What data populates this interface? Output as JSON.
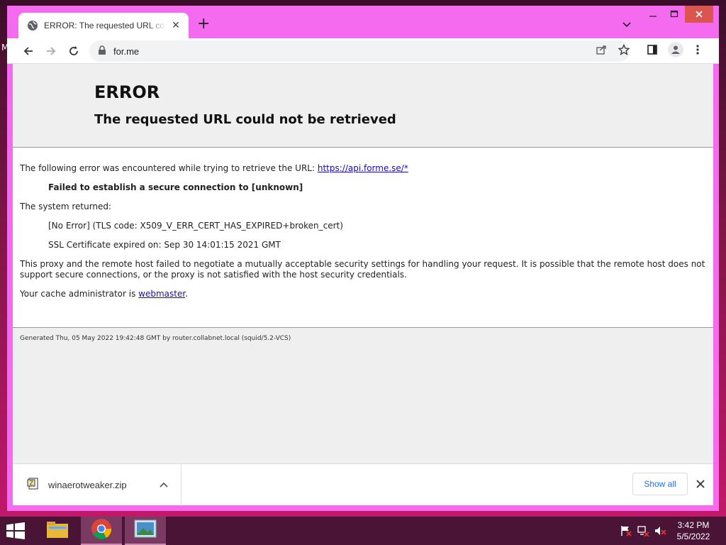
{
  "desktop": {
    "edge_letter": "M"
  },
  "tab": {
    "title": "ERROR: The requested URL could not be retrieved",
    "close": "✕"
  },
  "newtab": {
    "label": "+"
  },
  "omnibox": {
    "url": "for.me"
  },
  "page": {
    "h1": "ERROR",
    "h2": "The requested URL could not be retrieved",
    "line1_prefix": "The following error was encountered while trying to retrieve the URL: ",
    "line1_link": "https://api.forme.se/*",
    "failed": "Failed to establish a secure connection to [unknown]",
    "system_returned": "The system returned:",
    "no_error": "[No Error] (TLS code: X509_V_ERR_CERT_HAS_EXPIRED+broken_cert)",
    "ssl_expired": "SSL Certificate expired on: Sep 30 14:01:15 2021 GMT",
    "proxy_msg": "This proxy and the remote host failed to negotiate a mutually acceptable security settings for handling your request. It is possible that the remote host does not support secure connections, or the proxy is not satisfied with the host security credentials.",
    "admin_prefix": "Your cache administrator is ",
    "admin_link": "webmaster",
    "admin_suffix": ".",
    "footer": "Generated Thu, 05 May 2022 19:42:48 GMT by router.collabnet.local (squid/5.2-VCS)"
  },
  "downloads": {
    "file": "winaerotweaker.zip",
    "show_all": "Show all"
  },
  "clock": {
    "time": "3:42 PM",
    "date": "5/5/2022"
  },
  "colors": {
    "window_frame": "#f56bef",
    "taskbar": "#4a1437",
    "link": "#1a0dab"
  }
}
